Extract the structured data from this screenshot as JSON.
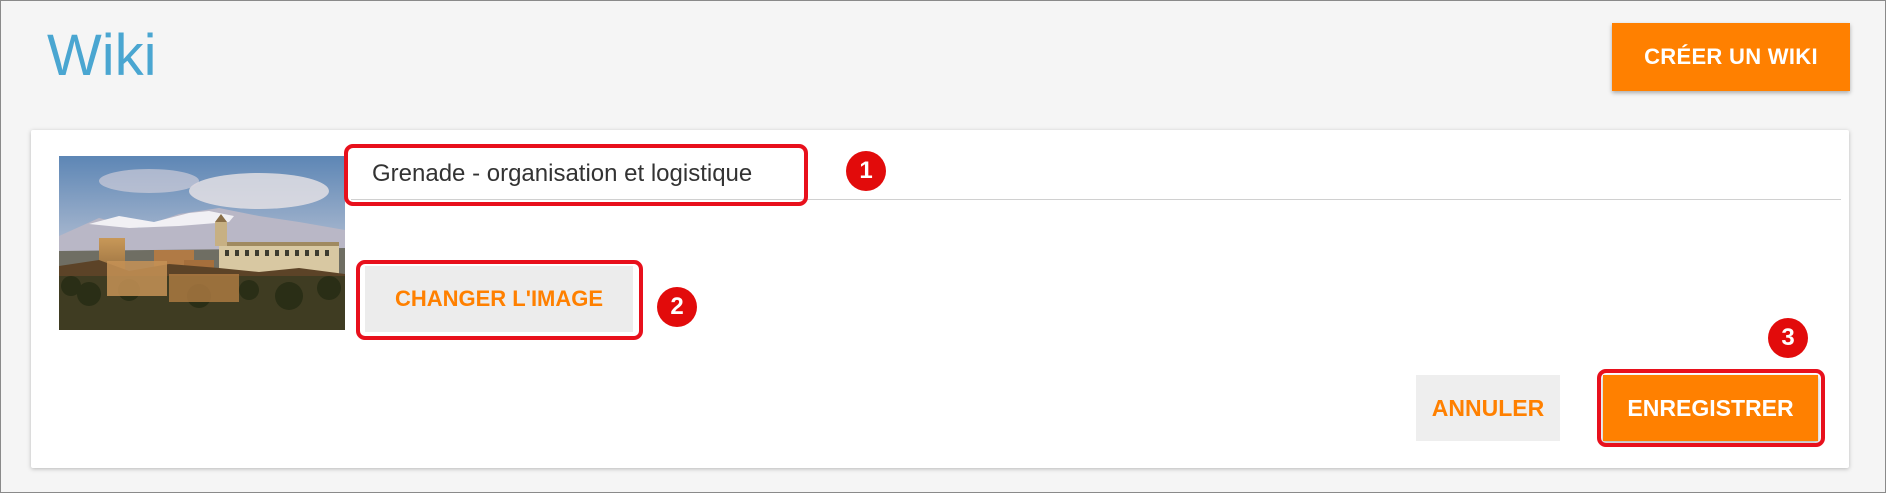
{
  "header": {
    "title": "Wiki",
    "create_button": "CRÉER UN WIKI"
  },
  "editor": {
    "wiki_title_value": "Grenade - organisation et logistique",
    "change_image_label": "CHANGER L'IMAGE",
    "cancel_label": "ANNULER",
    "save_label": "ENREGISTRER",
    "image_alt": "Alhambra, Grenade"
  },
  "callouts": [
    "1",
    "2",
    "3"
  ],
  "colors": {
    "accent": "#ff8000",
    "title": "#4aa6d1",
    "highlight": "#e8101c"
  }
}
